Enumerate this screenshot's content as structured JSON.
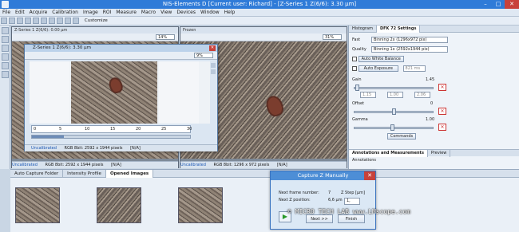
{
  "window": {
    "title": "NIS-Elements D [Current user: Richard] - [Z-Series 1   Z(6/6): 3.30 μm]"
  },
  "menu": [
    "File",
    "Edit",
    "Acquire",
    "Calibration",
    "Image",
    "ROI",
    "Measure",
    "Macro",
    "View",
    "Devices",
    "Window",
    "Help"
  ],
  "toolbar": {
    "customize": "Customize"
  },
  "doc_left": {
    "tab": "Z-Series 1   Z(6/6): 0.00 μm",
    "zoom": "14%"
  },
  "doc_mid": {
    "tab": "Frozen",
    "zoom": "31%"
  },
  "doc_float": {
    "title": "Z-Series 1   Z(6/6): 3.30 μm",
    "zoom": "9%",
    "ruler": [
      "0",
      "5",
      "10",
      "15",
      "20",
      "25",
      "30"
    ],
    "status_uncal": "Uncalibrated",
    "status_info": "RGB 8bit: 2592 x 1944 pixels",
    "status_na": "[N/A]"
  },
  "status_left": {
    "uncal": "Uncalibrated",
    "info": "RGB 8bit: 2592 x 1944 pixels",
    "na": "[N/A]"
  },
  "status_mid": {
    "uncal": "Uncalibrated",
    "info": "RGB 8bit: 1296 x 972 pixels",
    "na": "[N/A]"
  },
  "right_panel": {
    "tabs": [
      "Histogram",
      "DFK 72 Settings"
    ],
    "fast_label": "Fast",
    "fast_value": "Binning 2x (1296x972 pix)",
    "quality_label": "Quality",
    "quality_value": "Binning 1x (2592x1944 pix)",
    "awb": "Auto White Balance",
    "auto_exposure": "Auto Exposure",
    "exposure_value": "821 ms",
    "gain_label": "Gain",
    "gain_value": "1.45",
    "gain_min": "1.15",
    "gain_mid": "1.00",
    "gain_max": "2.06",
    "offset_label": "Offset",
    "offset_value": "0",
    "gamma_label": "Gamma",
    "gamma_value": "1.00",
    "commands": "Commands",
    "bottom_tabs": [
      "Annotations and Measurements",
      "Preview"
    ],
    "annotations_label": "Annotations"
  },
  "bottom_panel": {
    "tabs": [
      "Auto Capture Folder",
      "Intensity Profile",
      "Opened Images"
    ]
  },
  "dialog": {
    "title": "Capture Z Manually",
    "next_frame_label": "Next frame number:",
    "next_frame_value": "7",
    "next_pos_label": "Next Z position:",
    "next_pos_value": "6,6 μm",
    "zstep_label": "Z Step [μm]",
    "zstep_value": "1,",
    "next_btn": "Next >>",
    "finish_btn": "Finish"
  },
  "watermark": "© MICRO TECH LAB  www.LMscope.com"
}
